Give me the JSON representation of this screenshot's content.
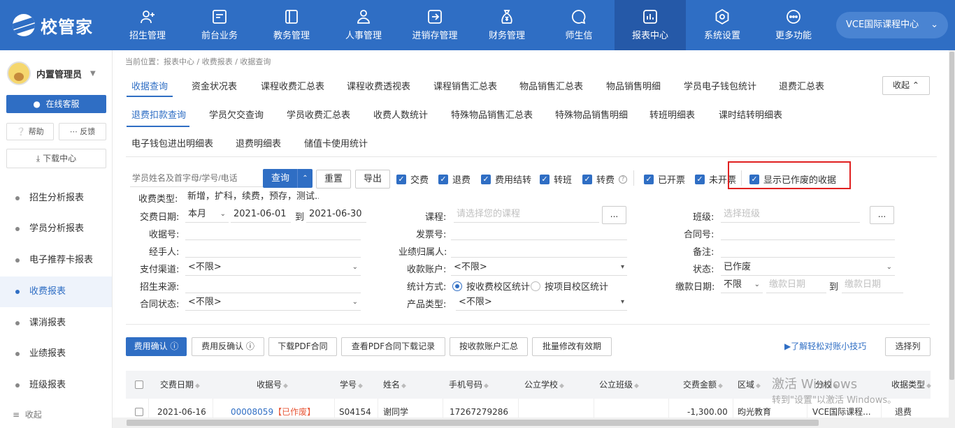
{
  "app": {
    "logo_text": "校管家"
  },
  "nav": [
    {
      "label": "招生管理",
      "icon": "user-add-icon"
    },
    {
      "label": "前台业务",
      "icon": "monitor-icon"
    },
    {
      "label": "教务管理",
      "icon": "book-icon"
    },
    {
      "label": "人事管理",
      "icon": "person-icon"
    },
    {
      "label": "进销存管理",
      "icon": "exchange-icon"
    },
    {
      "label": "财务管理",
      "icon": "money-bag-icon"
    },
    {
      "label": "师生信",
      "icon": "chat-icon"
    },
    {
      "label": "报表中心",
      "icon": "bar-chart-icon",
      "active": true
    },
    {
      "label": "系统设置",
      "icon": "settings-icon"
    },
    {
      "label": "更多功能",
      "icon": "more-icon"
    }
  ],
  "campus": {
    "label": "VCE国际课程中心"
  },
  "sidebar": {
    "user_name": "内置管理员",
    "online_service": "在线客服",
    "help": "帮助",
    "feedback": "反馈",
    "download_center": "下载中心",
    "items": [
      {
        "label": "招生分析报表"
      },
      {
        "label": "学员分析报表"
      },
      {
        "label": "电子推荐卡报表"
      },
      {
        "label": "收费报表",
        "active": true
      },
      {
        "label": "课消报表"
      },
      {
        "label": "业绩报表"
      },
      {
        "label": "班级报表"
      }
    ],
    "collapse": "收起"
  },
  "breadcrumb": "当前位置：报表中心 / 收费报表 / 收据查询",
  "tabs": {
    "row1": [
      "收据查询",
      "资金状况表",
      "课程收费汇总表",
      "课程收费透视表",
      "课程销售汇总表",
      "物品销售汇总表",
      "物品销售明细",
      "学员电子钱包统计",
      "退费汇总表"
    ],
    "row2": [
      "退费扣款查询",
      "学员欠交查询",
      "学员收费汇总表",
      "收费人数统计",
      "特殊物品销售汇总表",
      "特殊物品销售明细",
      "转班明细表",
      "课时结转明细表"
    ],
    "row3": [
      "电子钱包进出明细表",
      "退费明细表",
      "储值卡使用统计"
    ],
    "fold": "收起"
  },
  "toolbar": {
    "search_placeholder": "学员姓名及首字母/学号/电话",
    "query": "查询",
    "reset": "重置",
    "export": "导出",
    "checks": [
      "交费",
      "退费",
      "费用结转",
      "转班",
      "转费",
      "已开票",
      "未开票",
      "显示已作废的收据"
    ]
  },
  "filters": {
    "fee_type_label": "收费类型:",
    "fee_type_value": "新增，扩科，续费，预存，测试...",
    "date_label": "交费日期:",
    "date_range": "本月",
    "date_from": "2021-06-01",
    "date_to_label": "到",
    "date_to": "2021-06-30",
    "course_label": "课程:",
    "course_placeholder": "请选择您的课程",
    "class_label": "班级:",
    "class_placeholder": "选择班级",
    "dots": "...",
    "receipt_label": "收据号:",
    "invoice_label": "发票号:",
    "contract_label": "合同号:",
    "handler_label": "经手人:",
    "owner_label": "业绩归属人:",
    "remark_label": "备注:",
    "pay_channel_label": "支付渠道:",
    "pay_channel_value": "<不限>",
    "account_label": "收款账户:",
    "account_value": "<不限>",
    "status_label": "状态:",
    "status_value": "已作废",
    "source_label": "招生来源:",
    "stat_label": "统计方式:",
    "stat_opt1": "按收费校区统计",
    "stat_opt2": "按项目校区统计",
    "paydate_label": "缴款日期:",
    "paydate_range": "不限",
    "paydate_from": "缴款日期",
    "paydate_to_label": "到",
    "paydate_to": "缴款日期",
    "contract_status_label": "合同状态:",
    "contract_status_value": "<不限>",
    "product_type_label": "产品类型:",
    "product_type_value": "<不限>"
  },
  "actions": {
    "confirm": "费用确认",
    "unconfirm": "费用反确认",
    "download_pdf": "下载PDF合同",
    "view_pdf_log": "查看PDF合同下载记录",
    "by_account": "按收款账户汇总",
    "batch_valid": "批量修改有效期",
    "tip": "了解轻松对账小技巧",
    "choose_cols": "选择列"
  },
  "table": {
    "headers": [
      "交费日期",
      "收据号",
      "学号",
      "姓名",
      "手机号码",
      "公立学校",
      "公立班级",
      "交费金额",
      "区域",
      "分校",
      "收据类型"
    ],
    "rows": [
      {
        "date": "2021-06-16",
        "receipt": "00008059",
        "void_tag": "【已作废】",
        "student_no": "S04154",
        "name": "谢同学",
        "phone": "17267279286",
        "school": "",
        "class": "",
        "amount": "-1,300.00",
        "region": "昀光教育",
        "campus": "VCE国际课程...",
        "type": "退费"
      }
    ]
  },
  "watermark": {
    "line1": "激活 Windows",
    "line2": "转到\"设置\"以激活 Windows。"
  }
}
